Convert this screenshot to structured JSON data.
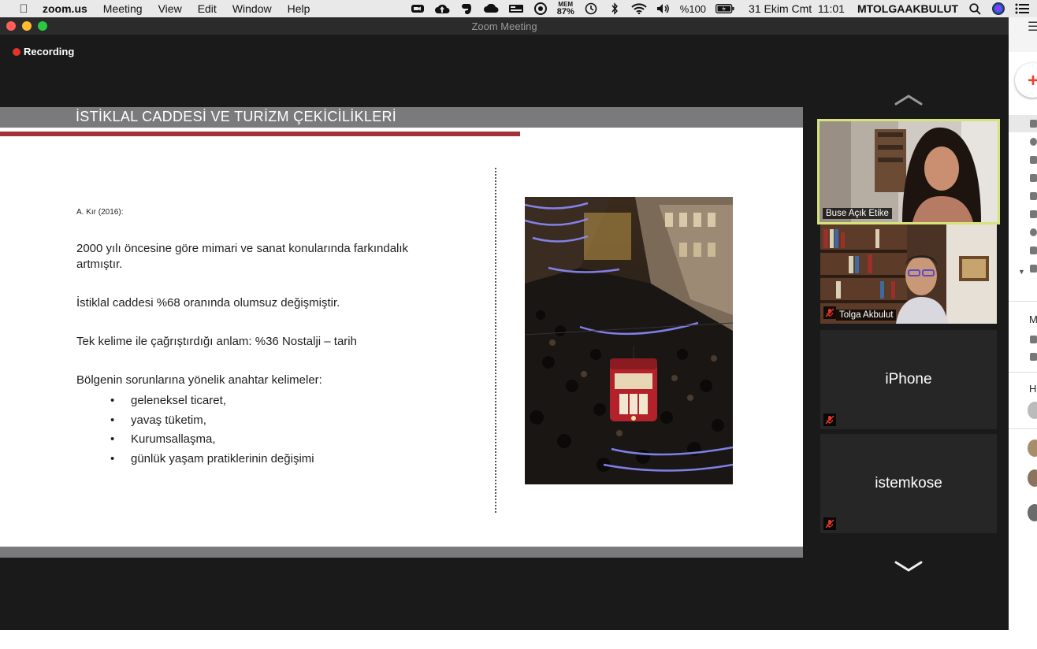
{
  "menubar": {
    "app_name": "zoom.us",
    "menus": [
      "Meeting",
      "View",
      "Edit",
      "Window",
      "Help"
    ],
    "memory_label": "MEM",
    "memory_value": "87%",
    "battery": "%100",
    "datetime": "31 Ekim Cmt  11:01",
    "user": "MTOLGAAKBULUT"
  },
  "window": {
    "title": "Zoom Meeting",
    "recording_label": "Recording"
  },
  "slide": {
    "title": "İSTİKLAL CADDESİ VE TURİZM ÇEKİCİLİKLERİ",
    "source": "A. Kır (2016):",
    "paragraphs": [
      "2000 yılı öncesine göre mimari ve sanat konularında farkındalık artmıştır.",
      "İstiklal caddesi %68 oranında olumsuz değişmiştir.",
      "Tek kelime ile çağrıştırdığı anlam: %36 Nostalji – tarih",
      "Bölgenin sorunlarına yönelik anahtar kelimeler:"
    ],
    "bullets": [
      "geleneksel ticaret,",
      "yavaş tüketim,",
      "Kurumsallaşma,",
      "günlük yaşam pratiklerinin değişimi"
    ]
  },
  "participants": [
    {
      "name": "Buse Açık Etike",
      "video": true,
      "muted": false,
      "active_speaker": true
    },
    {
      "name": "Tolga Akbulut",
      "video": true,
      "muted": true,
      "active_speaker": false
    },
    {
      "name": "iPhone",
      "video": false,
      "muted": true,
      "active_speaker": false
    },
    {
      "name": "istemkose",
      "video": false,
      "muted": true,
      "active_speaker": false
    }
  ],
  "sidebar": {
    "label_m": "M",
    "label_h": "H"
  },
  "colors": {
    "slide_band": "#7a7a7c",
    "slide_accent": "#a33338",
    "active_speaker_border": "#d6e37a",
    "recording_dot": "#e5332a"
  }
}
